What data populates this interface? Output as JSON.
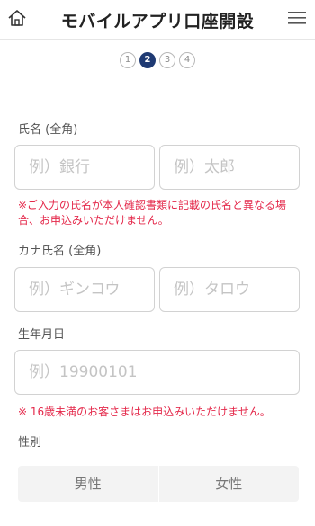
{
  "header": {
    "title": "モバイルアプリ口座開設",
    "home_icon": "home-icon",
    "menu_icon": "hamburger-menu-icon"
  },
  "steps": {
    "items": [
      "1",
      "2",
      "3",
      "4"
    ],
    "current": "2",
    "active_color": "#1f3a73"
  },
  "form": {
    "name_label": "氏名 (全角)",
    "last_name_placeholder": "例）銀行",
    "first_name_placeholder": "例）太郎",
    "name_note": "※ご入力の氏名が本人確認書類に記載の氏名と異なる場合、お申込みいただけません。",
    "kana_label": "カナ氏名 (全角)",
    "last_kana_placeholder": "例）ギンコウ",
    "first_kana_placeholder": "例）タロウ",
    "birth_label": "生年月日",
    "birth_placeholder": "例）19900101",
    "birth_note": "※ 16歳未満のお客さまはお申込みいただけません。",
    "gender_label": "性別",
    "gender_options": [
      "男性",
      "女性"
    ],
    "note_color": "#e4284a"
  }
}
